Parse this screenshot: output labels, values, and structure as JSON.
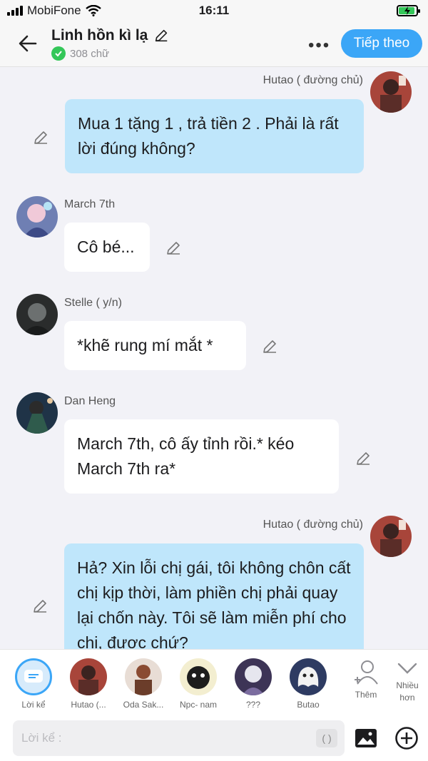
{
  "status_bar": {
    "carrier": "MobiFone",
    "time": "16:11",
    "battery_state": "charging"
  },
  "header": {
    "title": "Linh hồn kì lạ",
    "word_count": "308 chữ",
    "next_label": "Tiếp theo",
    "more_label": "•••"
  },
  "messages": [
    {
      "sender": "Hutao ( đường chủ)",
      "text": "Mua 1 tặng 1 , trả tiền 2 . Phải là rất lời đúng không?",
      "side": "right"
    },
    {
      "sender": "March 7th",
      "text": "Cô bé...",
      "side": "left"
    },
    {
      "sender": "Stelle ( y/n)",
      "text": "*khẽ rung mí mắt *",
      "side": "left"
    },
    {
      "sender": "Dan Heng",
      "text": "March 7th, cô ấy tỉnh rồi.* kéo March 7th ra*",
      "side": "left"
    },
    {
      "sender": "Hutao ( đường chủ)",
      "text": "Hả? Xin lỗi chị gái, tôi không chôn cất chị kịp thời, làm phiền chị phải quay lại chốn này. Tôi sẽ làm miễn phí cho chị, được chứ?",
      "side": "right"
    }
  ],
  "characters": [
    {
      "label": "Lời kể"
    },
    {
      "label": "Hutao (..."
    },
    {
      "label": "Oda Sak..."
    },
    {
      "label": "Npc- nam"
    },
    {
      "label": "???"
    },
    {
      "label": "Butao"
    },
    {
      "label": "Thêm"
    },
    {
      "label": "Nhiều hơn"
    }
  ],
  "input": {
    "placeholder": "Lời kể :",
    "paren_label": "( )"
  },
  "colors": {
    "accent": "#3ba6f7",
    "own_bubble": "#bfe6fb",
    "other_bubble": "#ffffff",
    "background": "#f2f2f7",
    "check": "#34c759"
  }
}
